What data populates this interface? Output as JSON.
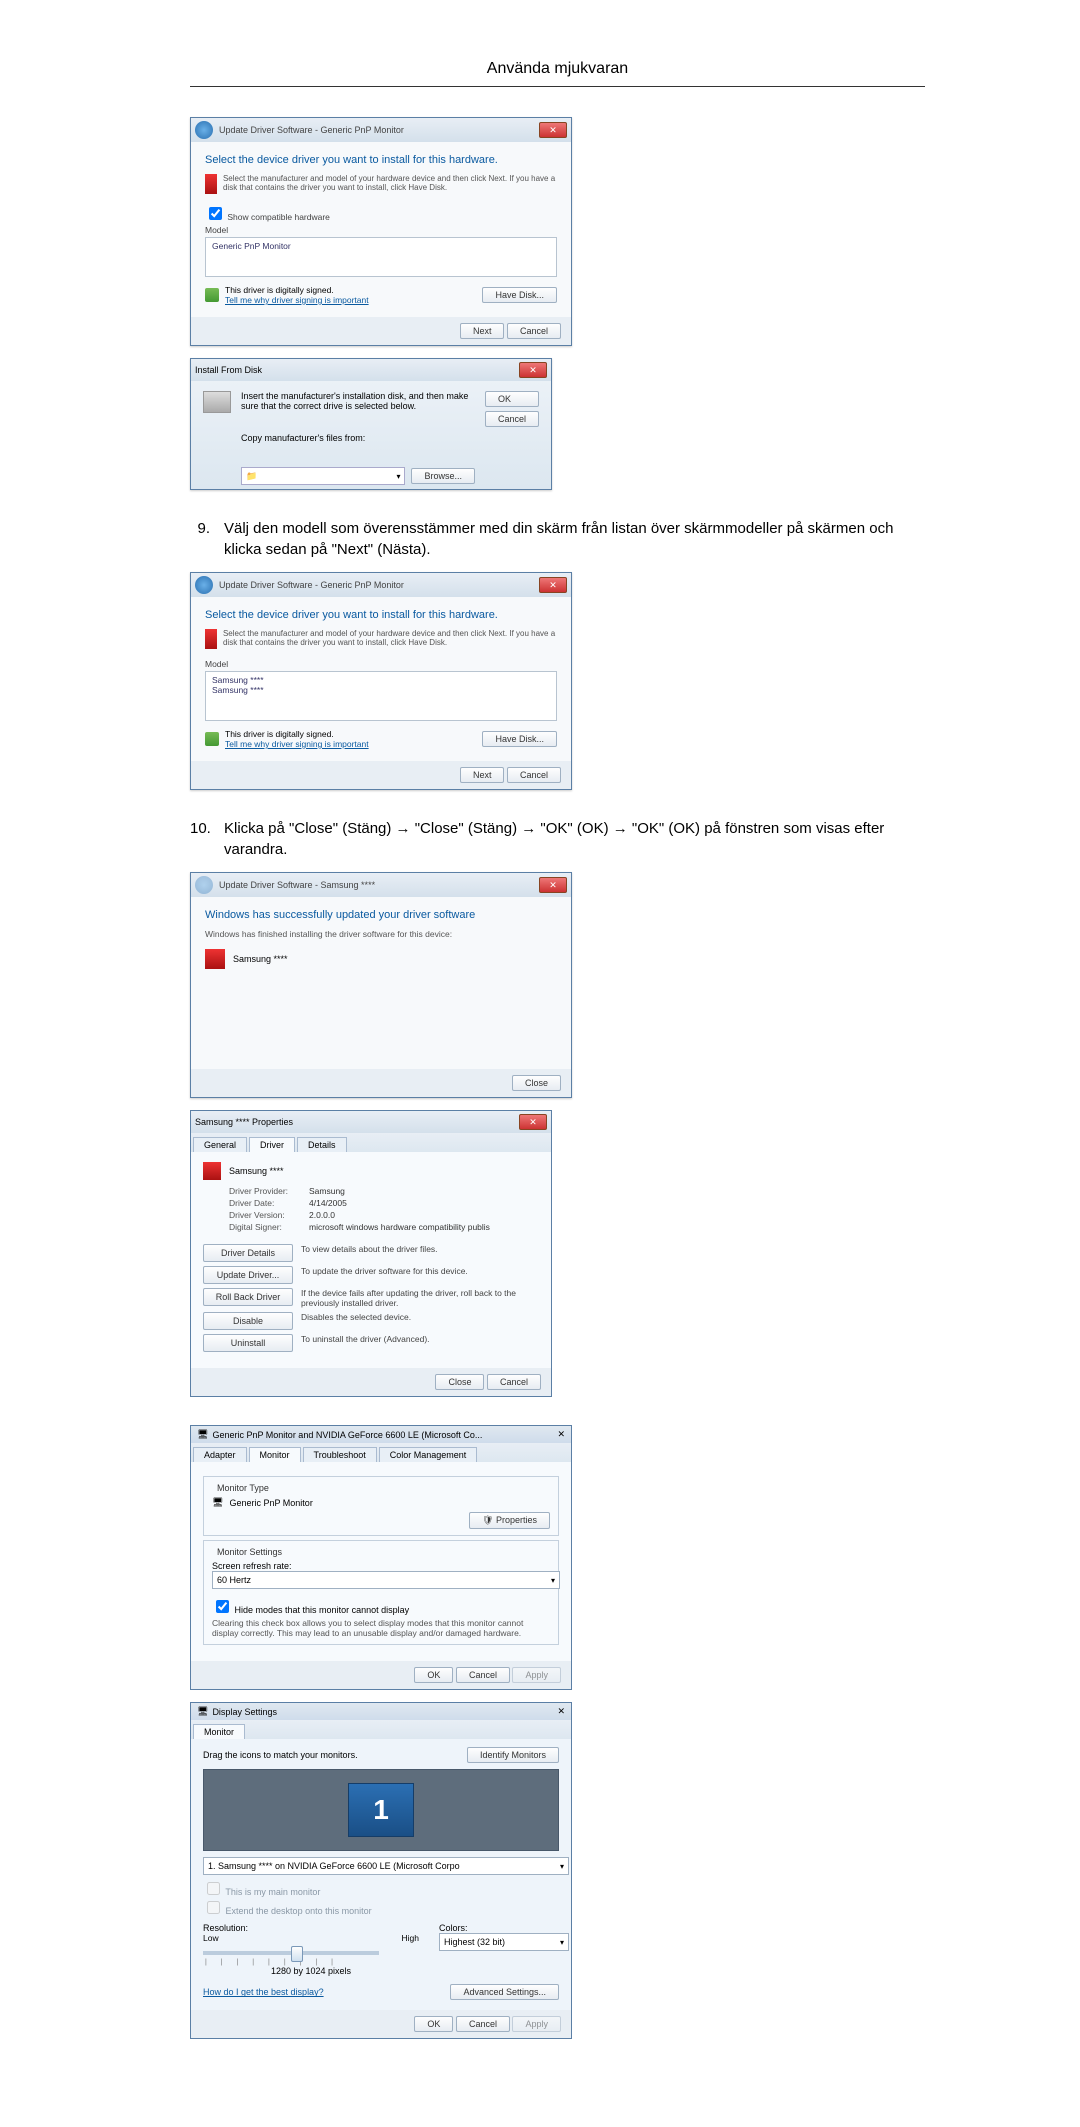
{
  "header": "Använda mjukvaran",
  "step9": {
    "num": "9.",
    "text": "Välj den modell som överensstämmer med din skärm från listan över skärmmodeller på skärmen och klicka sedan på \"Next\" (Nästa)."
  },
  "step10": {
    "num": "10.",
    "text": "Klicka på \"Close\" (Stäng) → \"Close\" (Stäng) → \"OK\" (OK) → \"OK\" (OK) på fönstren som visas efter varandra."
  },
  "wiz1": {
    "breadcrumb": "Update Driver Software - Generic PnP Monitor",
    "heading": "Select the device driver you want to install for this hardware.",
    "hint": "Select the manufacturer and model of your hardware device and then click Next. If you have a disk that contains the driver you want to install, click Have Disk.",
    "show_compat": "Show compatible hardware",
    "model_label": "Model",
    "model_item": "Generic PnP Monitor",
    "signed": "This driver is digitally signed.",
    "signed_link": "Tell me why driver signing is important",
    "have_disk": "Have Disk...",
    "next": "Next",
    "cancel": "Cancel"
  },
  "ifd": {
    "title": "Install From Disk",
    "instr": "Insert the manufacturer's installation disk, and then make sure that the correct drive is selected below.",
    "copy_label": "Copy manufacturer's files from:",
    "ok": "OK",
    "cancel": "Cancel",
    "browse": "Browse..."
  },
  "wiz2": {
    "breadcrumb": "Update Driver Software - Generic PnP Monitor",
    "heading": "Select the device driver you want to install for this hardware.",
    "hint": "Select the manufacturer and model of your hardware device and then click Next. If you have a disk that contains the driver you want to install, click Have Disk.",
    "model_label": "Model",
    "items": [
      "Samsung ****",
      "Samsung ****"
    ],
    "signed": "This driver is digitally signed.",
    "signed_link": "Tell me why driver signing is important",
    "have_disk": "Have Disk...",
    "next": "Next",
    "cancel": "Cancel"
  },
  "finish": {
    "breadcrumb": "Update Driver Software - Samsung ****",
    "heading": "Windows has successfully updated your driver software",
    "sub": "Windows has finished installing the driver software for this device:",
    "device": "Samsung ****",
    "close": "Close"
  },
  "props": {
    "title": "Samsung **** Properties",
    "tabs": [
      "General",
      "Driver",
      "Details"
    ],
    "device": "Samsung ****",
    "provider_k": "Driver Provider:",
    "provider_v": "Samsung",
    "date_k": "Driver Date:",
    "date_v": "4/14/2005",
    "version_k": "Driver Version:",
    "version_v": "2.0.0.0",
    "signer_k": "Digital Signer:",
    "signer_v": "microsoft windows hardware compatibility publis",
    "b_details": "Driver Details",
    "d_details": "To view details about the driver files.",
    "b_update": "Update Driver...",
    "d_update": "To update the driver software for this device.",
    "b_rollback": "Roll Back Driver",
    "d_rollback": "If the device fails after updating the driver, roll back to the previously installed driver.",
    "b_disable": "Disable",
    "d_disable": "Disables the selected device.",
    "b_uninstall": "Uninstall",
    "d_uninstall": "To uninstall the driver (Advanced).",
    "close": "Close",
    "cancel": "Cancel"
  },
  "monTab": {
    "title": "Generic PnP Monitor and NVIDIA GeForce 6600 LE (Microsoft Co...",
    "tabs": [
      "Adapter",
      "Monitor",
      "Troubleshoot",
      "Color Management"
    ],
    "group_type": "Monitor Type",
    "type_value": "Generic PnP Monitor",
    "properties": "Properties",
    "group_settings": "Monitor Settings",
    "refresh_label": "Screen refresh rate:",
    "refresh_value": "60 Hertz",
    "hide_modes": "Hide modes that this monitor cannot display",
    "hide_hint": "Clearing this check box allows you to select display modes that this monitor cannot display correctly. This may lead to an unusable display and/or damaged hardware.",
    "ok": "OK",
    "cancel": "Cancel",
    "apply": "Apply"
  },
  "ds": {
    "title": "Display Settings",
    "tab": "Monitor",
    "drag": "Drag the icons to match your monitors.",
    "identify": "Identify Monitors",
    "mon_num": "1",
    "monitor_sel": "1. Samsung **** on NVIDIA GeForce 6600 LE (Microsoft Corpo",
    "chk_main": "This is my main monitor",
    "chk_extend": "Extend the desktop onto this monitor",
    "res_label": "Resolution:",
    "res_low": "Low",
    "res_high": "High",
    "res_value": "1280 by 1024 pixels",
    "colors_label": "Colors:",
    "colors_value": "Highest (32 bit)",
    "help_link": "How do I get the best display?",
    "advanced": "Advanced Settings...",
    "ok": "OK",
    "cancel": "Cancel",
    "apply": "Apply"
  }
}
